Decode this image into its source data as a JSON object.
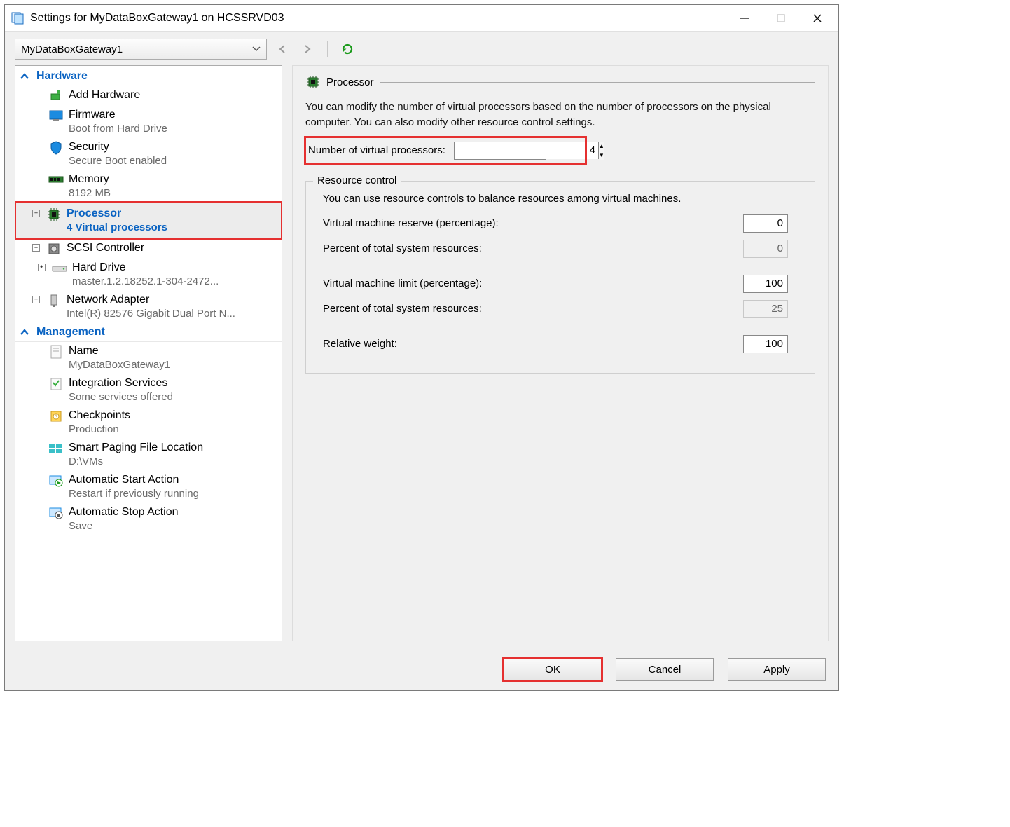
{
  "window": {
    "title": "Settings for MyDataBoxGateway1 on HCSSRVD03"
  },
  "toolbar": {
    "vm_name": "MyDataBoxGateway1"
  },
  "tree": {
    "hardware_label": "Hardware",
    "add_hardware": "Add Hardware",
    "firmware": {
      "label": "Firmware",
      "sub": "Boot from Hard Drive"
    },
    "security": {
      "label": "Security",
      "sub": "Secure Boot enabled"
    },
    "memory": {
      "label": "Memory",
      "sub": "8192 MB"
    },
    "processor": {
      "label": "Processor",
      "sub": "4 Virtual processors"
    },
    "scsi": {
      "label": "SCSI Controller"
    },
    "hdd": {
      "label": "Hard Drive",
      "sub": "master.1.2.18252.1-304-2472..."
    },
    "nic": {
      "label": "Network Adapter",
      "sub": "Intel(R) 82576 Gigabit Dual Port N..."
    },
    "management_label": "Management",
    "name": {
      "label": "Name",
      "sub": "MyDataBoxGateway1"
    },
    "integration": {
      "label": "Integration Services",
      "sub": "Some services offered"
    },
    "checkpoints": {
      "label": "Checkpoints",
      "sub": "Production"
    },
    "paging": {
      "label": "Smart Paging File Location",
      "sub": "D:\\VMs"
    },
    "autostart": {
      "label": "Automatic Start Action",
      "sub": "Restart if previously running"
    },
    "autostop": {
      "label": "Automatic Stop Action",
      "sub": "Save"
    }
  },
  "panel": {
    "title": "Processor",
    "description": "You can modify the number of virtual processors based on the number of processors on the physical computer. You can also modify other resource control settings.",
    "num_proc_label": "Number of virtual processors:",
    "num_proc_value": "4",
    "fieldset_legend": "Resource control",
    "fieldset_intro": "You can use resource controls to balance resources among virtual machines.",
    "reserve_label": "Virtual machine reserve (percentage):",
    "reserve_value": "0",
    "reserve_pct_label": "Percent of total system resources:",
    "reserve_pct_value": "0",
    "limit_label": "Virtual machine limit (percentage):",
    "limit_value": "100",
    "limit_pct_label": "Percent of total system resources:",
    "limit_pct_value": "25",
    "weight_label": "Relative weight:",
    "weight_value": "100"
  },
  "footer": {
    "ok": "OK",
    "cancel": "Cancel",
    "apply": "Apply"
  }
}
